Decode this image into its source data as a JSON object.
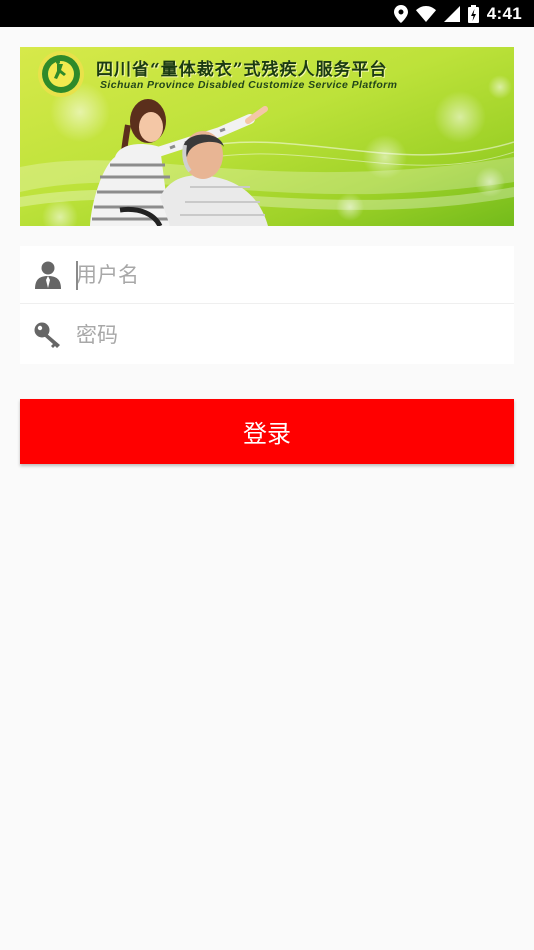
{
  "status_bar": {
    "time": "4:41",
    "icons": [
      "location-icon",
      "wifi-icon",
      "signal-icon",
      "battery-icon"
    ]
  },
  "banner": {
    "title": "四川省“量体裁衣”式残疾人服务平台",
    "subtitle": "Sichuan Province Disabled Customize Service Platform",
    "logo": "disability-federation-logo"
  },
  "form": {
    "username_placeholder": "用户名",
    "username_value": "",
    "password_placeholder": "密码",
    "password_value": "",
    "username_icon": "user-icon",
    "password_icon": "key-icon"
  },
  "login": {
    "label": "登录",
    "color": "#ff0000"
  },
  "colors": {
    "background": "#fafafa",
    "status_bar": "#000000"
  }
}
